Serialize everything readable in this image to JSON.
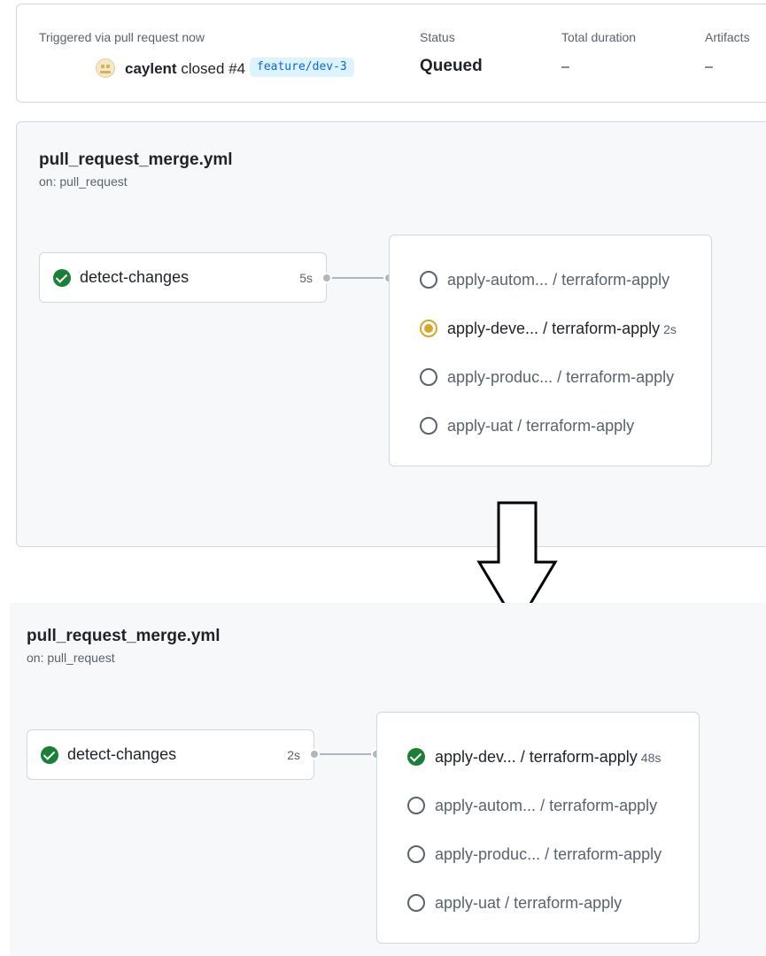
{
  "summary": {
    "trigger_label": "Triggered via pull request now",
    "actor": "caylent",
    "action_text": "closed #4",
    "branch": "feature/dev-3",
    "status_label": "Status",
    "status_value": "Queued",
    "duration_label": "Total duration",
    "duration_value": "–",
    "artifacts_label": "Artifacts",
    "artifacts_value": "–"
  },
  "before": {
    "title": "pull_request_merge.yml",
    "subtitle": "on: pull_request",
    "detect": {
      "name": "detect-changes",
      "duration": "5s",
      "status": "success"
    },
    "matrix": [
      {
        "name": "apply-autom...",
        "suffix": "/ terraform-apply",
        "duration": "",
        "status": "pending"
      },
      {
        "name": "apply-deve...",
        "suffix": "/ terraform-apply",
        "duration": "2s",
        "status": "in-progress"
      },
      {
        "name": "apply-produc...",
        "suffix": "/ terraform-apply",
        "duration": "",
        "status": "pending"
      },
      {
        "name": "apply-uat",
        "suffix": "/ terraform-apply",
        "duration": "",
        "status": "pending"
      }
    ]
  },
  "after": {
    "title": "pull_request_merge.yml",
    "subtitle": "on: pull_request",
    "detect": {
      "name": "detect-changes",
      "duration": "2s",
      "status": "success"
    },
    "matrix": [
      {
        "name": "apply-dev...",
        "suffix": "/ terraform-apply",
        "duration": "48s",
        "status": "success"
      },
      {
        "name": "apply-autom...",
        "suffix": "/ terraform-apply",
        "duration": "",
        "status": "pending"
      },
      {
        "name": "apply-produc...",
        "suffix": "/ terraform-apply",
        "duration": "",
        "status": "pending"
      },
      {
        "name": "apply-uat",
        "suffix": "/ terraform-apply",
        "duration": "",
        "status": "pending"
      }
    ]
  },
  "colors": {
    "success": "#1a7f37",
    "in_progress": "#d4a72c",
    "pending": "#59636e",
    "branch_text": "#0969da",
    "branch_bg": "#ddf4ff"
  }
}
